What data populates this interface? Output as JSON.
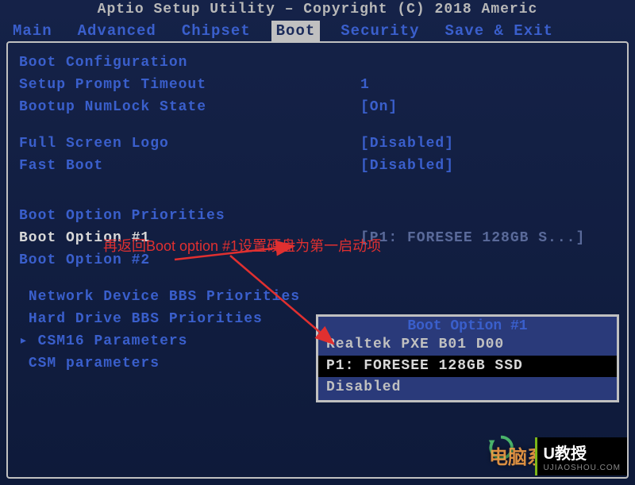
{
  "title": "Aptio Setup Utility – Copyright (C) 2018 Americ",
  "menu": {
    "items": [
      "Main",
      "Advanced",
      "Chipset",
      "Boot",
      "Security",
      "Save & Exit"
    ],
    "active_index": 3
  },
  "boot_page": {
    "section1_header": "Boot Configuration",
    "setup_prompt_timeout": {
      "label": "Setup Prompt Timeout",
      "value": "1"
    },
    "bootup_numlock": {
      "label": "Bootup NumLock State",
      "value": "[On]"
    },
    "full_screen_logo": {
      "label": "Full Screen Logo",
      "value": "[Disabled]"
    },
    "fast_boot": {
      "label": "Fast Boot",
      "value": "[Disabled]"
    },
    "section2_header": "Boot Option Priorities",
    "boot_option_1": {
      "label": "Boot Option #1",
      "value": "[P1: FORESEE 128GB S...]"
    },
    "boot_option_2": {
      "label": "Boot Option #2",
      "value": ""
    },
    "submenus": {
      "network_bbs": "Network Device BBS Priorities",
      "harddrive_bbs": "Hard Drive BBS Priorities",
      "csm16": "CSM16 Parameters",
      "csm": "CSM parameters"
    }
  },
  "popup": {
    "title": "Boot Option #1",
    "items": [
      "Realtek PXE B01 D00",
      "P1: FORESEE 128GB SSD",
      "Disabled"
    ],
    "selected_index": 1
  },
  "annotation": {
    "text": "再返回Boot option #1设置硬盘为第一启动项"
  },
  "watermarks": {
    "u_logo_main": "U教授",
    "u_logo_sub": "UJIAOSHOU.COM",
    "orange_text": "电脑系统城"
  }
}
